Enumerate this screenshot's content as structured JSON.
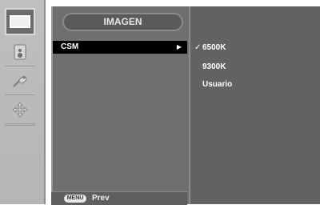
{
  "colors": {
    "rail": "#b8b8b8",
    "panel": "#6f6f6f",
    "submenu": "#626262",
    "highlight": "#000000",
    "text": "#ffffff"
  },
  "rail": {
    "items": [
      {
        "icon": "monitor-icon",
        "active": true
      },
      {
        "icon": "speaker-icon",
        "active": false
      },
      {
        "icon": "key-tag-icon",
        "active": false
      },
      {
        "icon": "move-arrows-icon",
        "active": false
      }
    ]
  },
  "main": {
    "title": "IMAGEN",
    "menu": [
      {
        "label": "CSM",
        "arrow": "▶",
        "selected": true
      }
    ]
  },
  "bottom": {
    "menu_key": "MENU",
    "prev_label": "Prev"
  },
  "submenu": {
    "items": [
      {
        "label": "6500K",
        "checked": true,
        "check": "✓"
      },
      {
        "label": "9300K",
        "checked": false
      },
      {
        "label": "Usuario",
        "checked": false
      }
    ]
  }
}
